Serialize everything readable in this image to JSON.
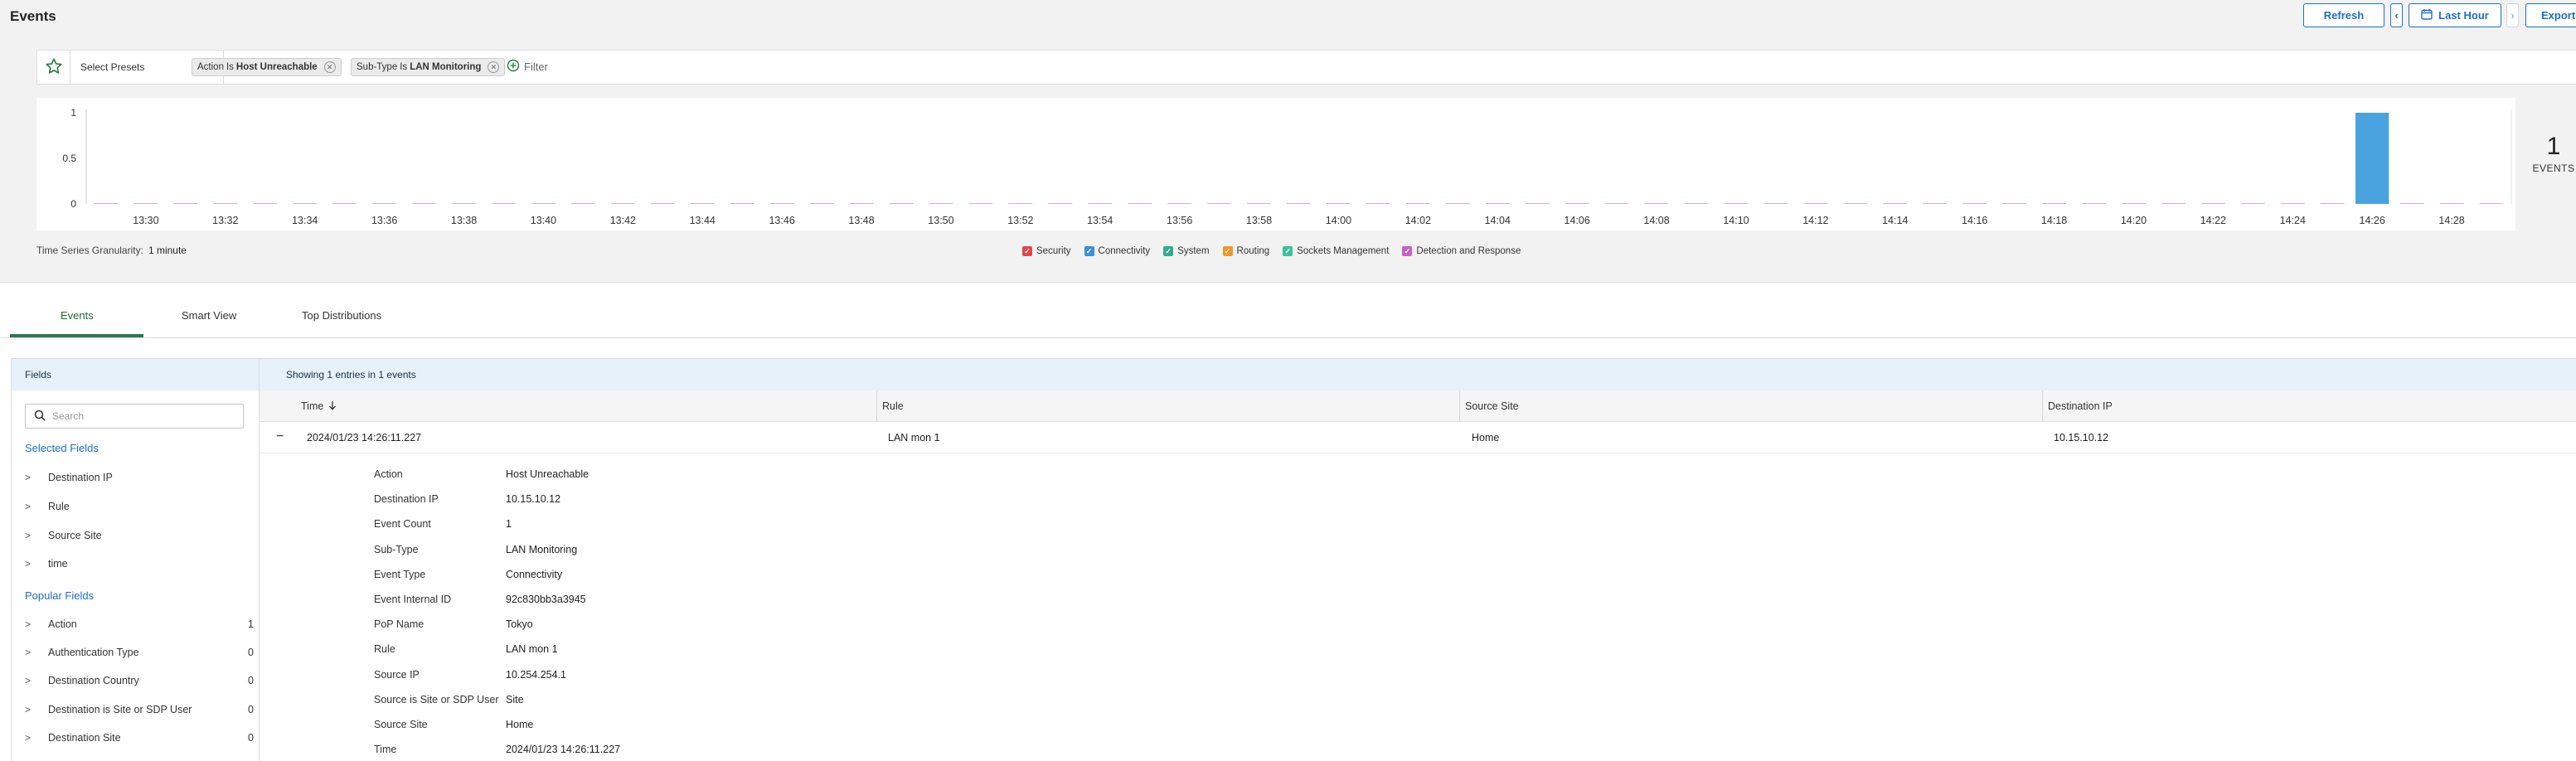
{
  "header": {
    "title": "Events",
    "refresh_label": "Refresh",
    "time_range_label": "Last Hour",
    "export_label": "Export"
  },
  "filter_bar": {
    "presets_label": "Select Presets",
    "chips": [
      {
        "key": "Action",
        "op": "Is",
        "value": "Host Unreachable"
      },
      {
        "key": "Sub-Type",
        "op": "Is",
        "value": "LAN Monitoring"
      }
    ],
    "add_filter_label": "Filter"
  },
  "chart_data": {
    "type": "bar",
    "y_ticks": [
      "1",
      "0.5",
      "0"
    ],
    "ylim": [
      0,
      1
    ],
    "x_tick_labels": [
      "13:30",
      "13:32",
      "13:34",
      "13:36",
      "13:38",
      "13:40",
      "13:42",
      "13:44",
      "13:46",
      "13:48",
      "13:50",
      "13:52",
      "13:54",
      "13:56",
      "13:58",
      "14:00",
      "14:02",
      "14:04",
      "14:06",
      "14:08",
      "14:10",
      "14:12",
      "14:14",
      "14:16",
      "14:18",
      "14:20",
      "14:22",
      "14:24",
      "14:26",
      "14:28"
    ],
    "series": [
      {
        "name": "Connectivity",
        "x": [
          "14:26"
        ],
        "values": [
          1
        ]
      }
    ],
    "bar_color": "#4aa3df"
  },
  "summary": {
    "count": "1",
    "label": "EVENTS"
  },
  "granularity": {
    "label": "Time Series Granularity:",
    "value": "1 minute"
  },
  "legend": [
    {
      "label": "Security",
      "color": "#e0474c"
    },
    {
      "label": "Connectivity",
      "color": "#3a8fd9"
    },
    {
      "label": "System",
      "color": "#2eae8c"
    },
    {
      "label": "Routing",
      "color": "#f0962e"
    },
    {
      "label": "Sockets Management",
      "color": "#39c39a"
    },
    {
      "label": "Detection and Response",
      "color": "#c860c8"
    }
  ],
  "tabs": [
    {
      "label": "Events"
    },
    {
      "label": "Smart View"
    },
    {
      "label": "Top Distributions"
    }
  ],
  "fields_panel": {
    "title": "Fields",
    "search_placeholder": "Search",
    "selected_title": "Selected Fields",
    "selected": [
      {
        "label": "Destination IP"
      },
      {
        "label": "Rule"
      },
      {
        "label": "Source Site"
      },
      {
        "label": "time"
      }
    ],
    "popular_title": "Popular Fields",
    "popular": [
      {
        "label": "Action",
        "count": "1"
      },
      {
        "label": "Authentication Type",
        "count": "0"
      },
      {
        "label": "Destination Country",
        "count": "0"
      },
      {
        "label": "Destination is Site or SDP User",
        "count": "0"
      },
      {
        "label": "Destination Site",
        "count": "0"
      }
    ]
  },
  "results": {
    "summary": "Showing 1 entries in 1 events",
    "columns": [
      "Time",
      "Rule",
      "Source Site",
      "Destination IP"
    ],
    "row": {
      "time": "2024/01/23 14:26:11.227",
      "rule": "LAN mon 1",
      "source_site": "Home",
      "destination_ip": "10.15.10.12"
    },
    "details": [
      {
        "key": "Action",
        "value": "Host Unreachable"
      },
      {
        "key": "Destination IP",
        "value": "10.15.10.12"
      },
      {
        "key": "Event Count",
        "value": "1"
      },
      {
        "key": "Sub-Type",
        "value": "LAN Monitoring"
      },
      {
        "key": "Event Type",
        "value": "Connectivity"
      },
      {
        "key": "Event Internal ID",
        "value": "92c830bb3a3945"
      },
      {
        "key": "PoP Name",
        "value": "Tokyo"
      },
      {
        "key": "Rule",
        "value": "LAN mon 1"
      },
      {
        "key": "Source IP",
        "value": "10.254.254.1"
      },
      {
        "key": "Source is Site or SDP User",
        "value": "Site"
      },
      {
        "key": "Source Site",
        "value": "Home"
      },
      {
        "key": "Time",
        "value": "2024/01/23 14:26:11.227"
      }
    ]
  }
}
